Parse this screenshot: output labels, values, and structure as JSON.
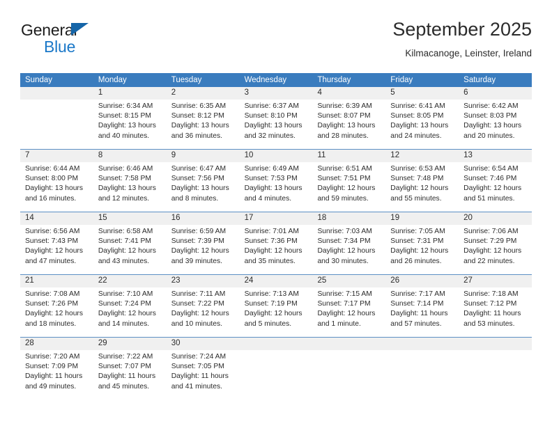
{
  "brand": {
    "line1": "General",
    "line2": "Blue",
    "triangle_color": "#1565a8",
    "blue_color": "#1b78c8"
  },
  "header": {
    "title": "September 2025",
    "subtitle": "Kilmacanoge, Leinster, Ireland"
  },
  "calendar": {
    "header_bg": "#3a7cbe",
    "band_bg": "#f0f0f0",
    "weekdays": [
      "Sunday",
      "Monday",
      "Tuesday",
      "Wednesday",
      "Thursday",
      "Friday",
      "Saturday"
    ],
    "weeks": [
      [
        {
          "day": "",
          "sunrise": "",
          "sunset": "",
          "daylight1": "",
          "daylight2": "",
          "empty": true
        },
        {
          "day": "1",
          "sunrise": "Sunrise: 6:34 AM",
          "sunset": "Sunset: 8:15 PM",
          "daylight1": "Daylight: 13 hours",
          "daylight2": "and 40 minutes."
        },
        {
          "day": "2",
          "sunrise": "Sunrise: 6:35 AM",
          "sunset": "Sunset: 8:12 PM",
          "daylight1": "Daylight: 13 hours",
          "daylight2": "and 36 minutes."
        },
        {
          "day": "3",
          "sunrise": "Sunrise: 6:37 AM",
          "sunset": "Sunset: 8:10 PM",
          "daylight1": "Daylight: 13 hours",
          "daylight2": "and 32 minutes."
        },
        {
          "day": "4",
          "sunrise": "Sunrise: 6:39 AM",
          "sunset": "Sunset: 8:07 PM",
          "daylight1": "Daylight: 13 hours",
          "daylight2": "and 28 minutes."
        },
        {
          "day": "5",
          "sunrise": "Sunrise: 6:41 AM",
          "sunset": "Sunset: 8:05 PM",
          "daylight1": "Daylight: 13 hours",
          "daylight2": "and 24 minutes."
        },
        {
          "day": "6",
          "sunrise": "Sunrise: 6:42 AM",
          "sunset": "Sunset: 8:03 PM",
          "daylight1": "Daylight: 13 hours",
          "daylight2": "and 20 minutes."
        }
      ],
      [
        {
          "day": "7",
          "sunrise": "Sunrise: 6:44 AM",
          "sunset": "Sunset: 8:00 PM",
          "daylight1": "Daylight: 13 hours",
          "daylight2": "and 16 minutes."
        },
        {
          "day": "8",
          "sunrise": "Sunrise: 6:46 AM",
          "sunset": "Sunset: 7:58 PM",
          "daylight1": "Daylight: 13 hours",
          "daylight2": "and 12 minutes."
        },
        {
          "day": "9",
          "sunrise": "Sunrise: 6:47 AM",
          "sunset": "Sunset: 7:56 PM",
          "daylight1": "Daylight: 13 hours",
          "daylight2": "and 8 minutes."
        },
        {
          "day": "10",
          "sunrise": "Sunrise: 6:49 AM",
          "sunset": "Sunset: 7:53 PM",
          "daylight1": "Daylight: 13 hours",
          "daylight2": "and 4 minutes."
        },
        {
          "day": "11",
          "sunrise": "Sunrise: 6:51 AM",
          "sunset": "Sunset: 7:51 PM",
          "daylight1": "Daylight: 12 hours",
          "daylight2": "and 59 minutes."
        },
        {
          "day": "12",
          "sunrise": "Sunrise: 6:53 AM",
          "sunset": "Sunset: 7:48 PM",
          "daylight1": "Daylight: 12 hours",
          "daylight2": "and 55 minutes."
        },
        {
          "day": "13",
          "sunrise": "Sunrise: 6:54 AM",
          "sunset": "Sunset: 7:46 PM",
          "daylight1": "Daylight: 12 hours",
          "daylight2": "and 51 minutes."
        }
      ],
      [
        {
          "day": "14",
          "sunrise": "Sunrise: 6:56 AM",
          "sunset": "Sunset: 7:43 PM",
          "daylight1": "Daylight: 12 hours",
          "daylight2": "and 47 minutes."
        },
        {
          "day": "15",
          "sunrise": "Sunrise: 6:58 AM",
          "sunset": "Sunset: 7:41 PM",
          "daylight1": "Daylight: 12 hours",
          "daylight2": "and 43 minutes."
        },
        {
          "day": "16",
          "sunrise": "Sunrise: 6:59 AM",
          "sunset": "Sunset: 7:39 PM",
          "daylight1": "Daylight: 12 hours",
          "daylight2": "and 39 minutes."
        },
        {
          "day": "17",
          "sunrise": "Sunrise: 7:01 AM",
          "sunset": "Sunset: 7:36 PM",
          "daylight1": "Daylight: 12 hours",
          "daylight2": "and 35 minutes."
        },
        {
          "day": "18",
          "sunrise": "Sunrise: 7:03 AM",
          "sunset": "Sunset: 7:34 PM",
          "daylight1": "Daylight: 12 hours",
          "daylight2": "and 30 minutes."
        },
        {
          "day": "19",
          "sunrise": "Sunrise: 7:05 AM",
          "sunset": "Sunset: 7:31 PM",
          "daylight1": "Daylight: 12 hours",
          "daylight2": "and 26 minutes."
        },
        {
          "day": "20",
          "sunrise": "Sunrise: 7:06 AM",
          "sunset": "Sunset: 7:29 PM",
          "daylight1": "Daylight: 12 hours",
          "daylight2": "and 22 minutes."
        }
      ],
      [
        {
          "day": "21",
          "sunrise": "Sunrise: 7:08 AM",
          "sunset": "Sunset: 7:26 PM",
          "daylight1": "Daylight: 12 hours",
          "daylight2": "and 18 minutes."
        },
        {
          "day": "22",
          "sunrise": "Sunrise: 7:10 AM",
          "sunset": "Sunset: 7:24 PM",
          "daylight1": "Daylight: 12 hours",
          "daylight2": "and 14 minutes."
        },
        {
          "day": "23",
          "sunrise": "Sunrise: 7:11 AM",
          "sunset": "Sunset: 7:22 PM",
          "daylight1": "Daylight: 12 hours",
          "daylight2": "and 10 minutes."
        },
        {
          "day": "24",
          "sunrise": "Sunrise: 7:13 AM",
          "sunset": "Sunset: 7:19 PM",
          "daylight1": "Daylight: 12 hours",
          "daylight2": "and 5 minutes."
        },
        {
          "day": "25",
          "sunrise": "Sunrise: 7:15 AM",
          "sunset": "Sunset: 7:17 PM",
          "daylight1": "Daylight: 12 hours",
          "daylight2": "and 1 minute."
        },
        {
          "day": "26",
          "sunrise": "Sunrise: 7:17 AM",
          "sunset": "Sunset: 7:14 PM",
          "daylight1": "Daylight: 11 hours",
          "daylight2": "and 57 minutes."
        },
        {
          "day": "27",
          "sunrise": "Sunrise: 7:18 AM",
          "sunset": "Sunset: 7:12 PM",
          "daylight1": "Daylight: 11 hours",
          "daylight2": "and 53 minutes."
        }
      ],
      [
        {
          "day": "28",
          "sunrise": "Sunrise: 7:20 AM",
          "sunset": "Sunset: 7:09 PM",
          "daylight1": "Daylight: 11 hours",
          "daylight2": "and 49 minutes."
        },
        {
          "day": "29",
          "sunrise": "Sunrise: 7:22 AM",
          "sunset": "Sunset: 7:07 PM",
          "daylight1": "Daylight: 11 hours",
          "daylight2": "and 45 minutes."
        },
        {
          "day": "30",
          "sunrise": "Sunrise: 7:24 AM",
          "sunset": "Sunset: 7:05 PM",
          "daylight1": "Daylight: 11 hours",
          "daylight2": "and 41 minutes."
        },
        {
          "day": "",
          "sunrise": "",
          "sunset": "",
          "daylight1": "",
          "daylight2": "",
          "empty": true
        },
        {
          "day": "",
          "sunrise": "",
          "sunset": "",
          "daylight1": "",
          "daylight2": "",
          "empty": true
        },
        {
          "day": "",
          "sunrise": "",
          "sunset": "",
          "daylight1": "",
          "daylight2": "",
          "empty": true
        },
        {
          "day": "",
          "sunrise": "",
          "sunset": "",
          "daylight1": "",
          "daylight2": "",
          "empty": true
        }
      ]
    ]
  }
}
